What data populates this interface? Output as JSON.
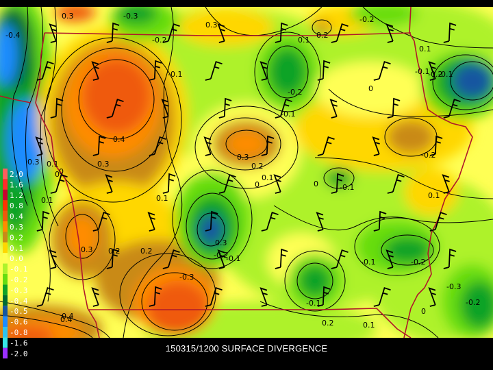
{
  "caption": "150315/1200 SURFACE DIVERGENCE",
  "legend": {
    "entries": [
      {
        "label": "2.0",
        "color": "#ff5d5d"
      },
      {
        "label": "1.6",
        "color": "#ff2a2a"
      },
      {
        "label": "1.2",
        "color": "#c8002e"
      },
      {
        "label": "0.8",
        "color": "#ff3300"
      },
      {
        "label": "0.4",
        "color": "#ef5a0c"
      },
      {
        "label": "0.3",
        "color": "#ff8c00"
      },
      {
        "label": "0.2",
        "color": "#c98a17"
      },
      {
        "label": "0.1",
        "color": "#ffd700"
      },
      {
        "label": "0.0",
        "color": "#ffff55"
      },
      {
        "label": "-0.1",
        "color": "#aef22c"
      },
      {
        "label": "-0.2",
        "color": "#66dd10"
      },
      {
        "label": "-0.3",
        "color": "#10a326"
      },
      {
        "label": "-0.4",
        "color": "#006d32"
      },
      {
        "label": "-0.5",
        "color": "#1456a0"
      },
      {
        "label": "-0.6",
        "color": "#1e8cff"
      },
      {
        "label": "-0.8",
        "color": "#2ec3ee"
      },
      {
        "label": "-1.6",
        "color": "#36e6e6"
      },
      {
        "label": "-2.0",
        "color": "#9b30ff"
      }
    ]
  },
  "contour_labels": [
    "-0.4",
    "0.3",
    "-0.3",
    "0.3",
    "-0.2",
    "0.2",
    "-0.2",
    "-0.1",
    "0.1",
    "0.1",
    "-0.1",
    "-0.2",
    "0",
    "-0.1",
    "-0.2",
    "0.4",
    "0.3",
    "-0.1",
    "0.3",
    "0.2",
    "0.1",
    "0",
    "0",
    "-0.1",
    "-0.2",
    "0.1",
    "0.1",
    "0",
    "0.1",
    "0.3",
    "0.2",
    "0.2",
    "0.3",
    "-0.2",
    "-0.1",
    "-0.1",
    "-0.2",
    "-0.3",
    "-0.2",
    "-0.1",
    "0",
    "-0.3",
    "0.4",
    "0.4",
    "0.3",
    "0.1",
    "0",
    "0.2",
    "0.1"
  ]
}
